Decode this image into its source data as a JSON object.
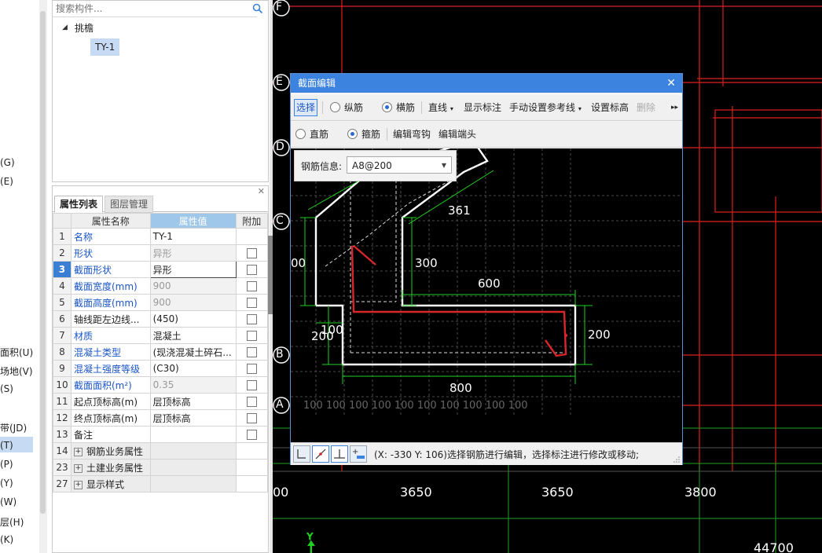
{
  "left_strip": {
    "items": [
      "(G)",
      "(E)",
      "面积(U)",
      "场地(V)",
      "(S)",
      "带(JD)",
      "(T)",
      "(P)",
      "(Y)",
      "(W)",
      "层(H)",
      "(K)"
    ]
  },
  "search": {
    "placeholder": "搜索构件..."
  },
  "tree": {
    "root": "挑檐",
    "child": "TY-1"
  },
  "prop_panel": {
    "tabs": [
      "属性列表",
      "图层管理"
    ],
    "headers": {
      "name": "属性名称",
      "value": "属性值",
      "extra": "附加"
    },
    "rows": [
      {
        "n": "1",
        "name": "名称",
        "value": "TY-1",
        "blue": true,
        "gray": false,
        "chk": false,
        "group": false
      },
      {
        "n": "2",
        "name": "形状",
        "value": "异形",
        "blue": true,
        "gray": true,
        "chk": true,
        "group": false
      },
      {
        "n": "3",
        "name": "截面形状",
        "value": "异形",
        "blue": true,
        "gray": false,
        "chk": true,
        "group": false,
        "sel": true
      },
      {
        "n": "4",
        "name": "截面宽度(mm)",
        "value": "900",
        "blue": true,
        "gray": true,
        "chk": true,
        "group": false
      },
      {
        "n": "5",
        "name": "截面高度(mm)",
        "value": "900",
        "blue": true,
        "gray": true,
        "chk": true,
        "group": false
      },
      {
        "n": "6",
        "name": "轴线距左边线...",
        "value": "(450)",
        "blue": false,
        "gray": false,
        "chk": true,
        "group": false
      },
      {
        "n": "7",
        "name": "材质",
        "value": "混凝土",
        "blue": true,
        "gray": false,
        "chk": true,
        "group": false
      },
      {
        "n": "8",
        "name": "混凝土类型",
        "value": "(现浇混凝土碎石...",
        "blue": true,
        "gray": false,
        "chk": true,
        "group": false
      },
      {
        "n": "9",
        "name": "混凝土强度等级",
        "value": "(C30)",
        "blue": true,
        "gray": false,
        "chk": true,
        "group": false
      },
      {
        "n": "10",
        "name": "截面面积(m²)",
        "value": "0.35",
        "blue": true,
        "gray": true,
        "chk": true,
        "group": false
      },
      {
        "n": "11",
        "name": "起点顶标高(m)",
        "value": "层顶标高",
        "blue": false,
        "gray": false,
        "chk": true,
        "group": false
      },
      {
        "n": "12",
        "name": "终点顶标高(m)",
        "value": "层顶标高",
        "blue": false,
        "gray": false,
        "chk": true,
        "group": false
      },
      {
        "n": "13",
        "name": "备注",
        "value": "",
        "blue": false,
        "gray": false,
        "chk": true,
        "group": false
      },
      {
        "n": "14",
        "name": "钢筋业务属性",
        "value": "",
        "blue": false,
        "gray": false,
        "chk": false,
        "group": true
      },
      {
        "n": "23",
        "name": "土建业务属性",
        "value": "",
        "blue": false,
        "gray": false,
        "chk": false,
        "group": true
      },
      {
        "n": "27",
        "name": "显示样式",
        "value": "",
        "blue": false,
        "gray": false,
        "chk": false,
        "group": true
      }
    ]
  },
  "canvas": {
    "axis_labels": [
      "F",
      "E",
      "D",
      "C",
      "B",
      "A"
    ],
    "dimensions": [
      "00",
      "3650",
      "3650",
      "3800",
      "44700"
    ],
    "y_axis": "Y"
  },
  "dialog": {
    "title": "截面编辑",
    "toolbar1": {
      "select": "选择",
      "longitudinal": "纵筋",
      "transverse": "横筋",
      "line": "直线",
      "show_dim": "显示标注",
      "ref_line": "手动设置参考线",
      "set_elev": "设置标高",
      "delete": "删除"
    },
    "toolbar2": {
      "straight": "直筋",
      "stirrup": "箍筋",
      "edit_hook": "编辑弯钩",
      "edit_end": "编辑端头"
    },
    "rebar_info": {
      "label": "钢筋信息:",
      "value": "A8@200"
    },
    "drawing_dims": [
      "361",
      "00",
      "300",
      "600",
      "100",
      "200",
      "200",
      "800"
    ],
    "bottom_ticks": [
      "100",
      "100",
      "100",
      "100",
      "100",
      "100",
      "100",
      "100",
      "100",
      "100"
    ],
    "status_text": "(X: -330 Y: 106)选择钢筋进行编辑，选择标注进行修改或移动;"
  },
  "colors": {
    "accent": "#3b83de",
    "grid_red": "#e0201c",
    "grid_green": "#1fa11f",
    "rebar_red": "#d9262b"
  }
}
